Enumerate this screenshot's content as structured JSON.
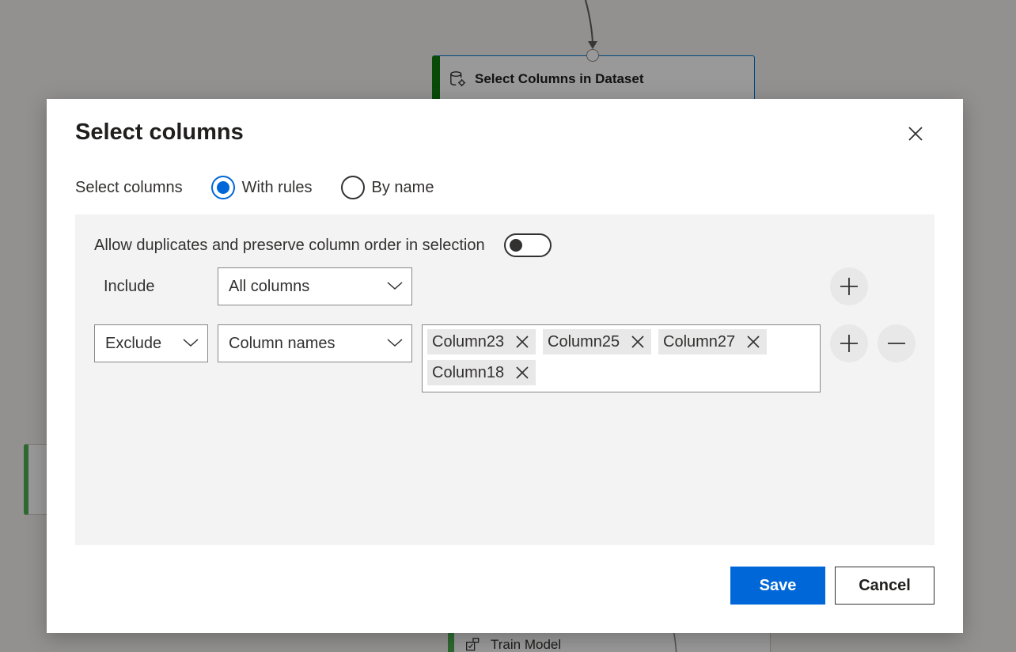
{
  "background": {
    "top_node_label": "Select Columns in Dataset",
    "bottom_node_label": "Train Model"
  },
  "dialog": {
    "title": "Select columns",
    "select_label": "Select columns",
    "radio_options": [
      {
        "label": "With rules",
        "checked": true
      },
      {
        "label": "By name",
        "checked": false
      }
    ],
    "toggle_label": "Allow duplicates and preserve column order in selection",
    "toggle_on": false,
    "include_label": "Include",
    "include_value": "All columns",
    "exclude_value": "Exclude",
    "column_names_value": "Column names",
    "tags": [
      "Column23",
      "Column25",
      "Column27",
      "Column18"
    ],
    "save_label": "Save",
    "cancel_label": "Cancel"
  },
  "colors": {
    "accent": "#0067d8",
    "node_green": "#107c10",
    "panel_bg": "#f3f3f3"
  }
}
